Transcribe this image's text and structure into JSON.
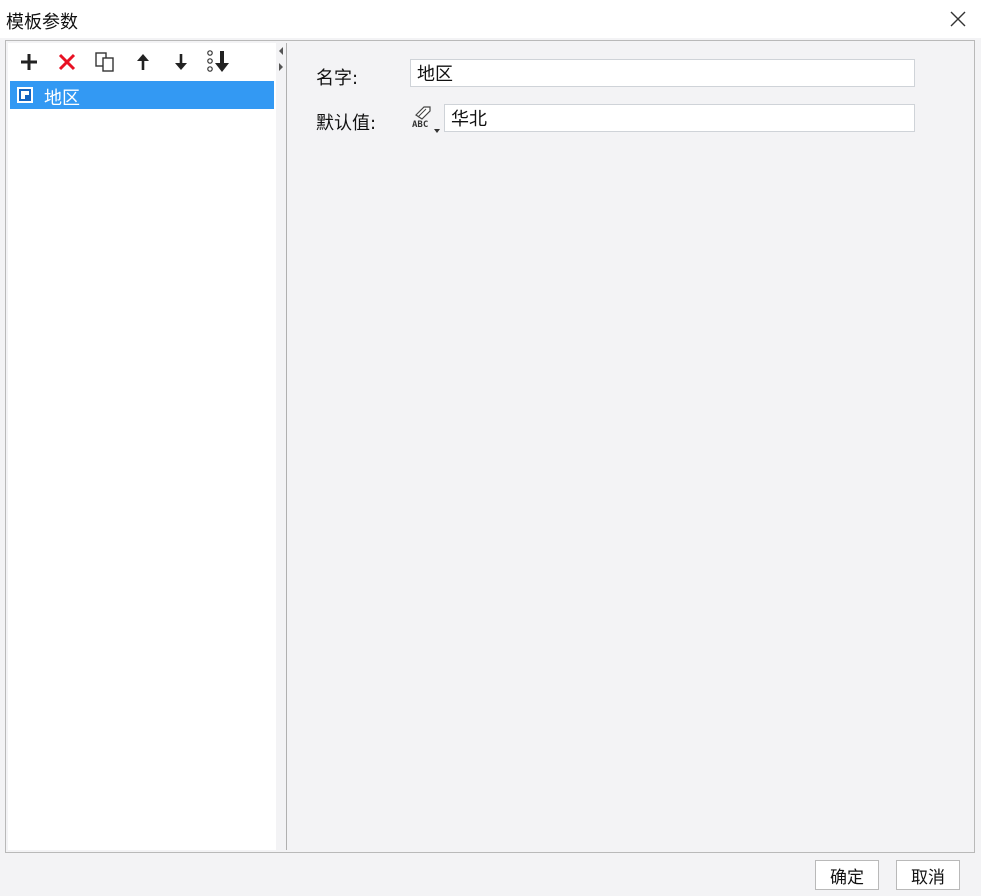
{
  "window": {
    "title": "模板参数"
  },
  "toolbar": {
    "buttons": [
      {
        "name": "add-icon"
      },
      {
        "name": "delete-icon"
      },
      {
        "name": "copy-icon"
      },
      {
        "name": "move-up-icon"
      },
      {
        "name": "move-down-icon"
      },
      {
        "name": "move-to-bottom-icon"
      }
    ]
  },
  "tree": {
    "items": [
      {
        "label": "地区",
        "selected": true
      }
    ]
  },
  "form": {
    "name_label": "名字:",
    "name_value": "地区",
    "default_label": "默认值:",
    "default_value": "华北",
    "type_icon": "abc-string-type-icon",
    "type_icon_text": "ABC"
  },
  "buttons": {
    "ok": "确定",
    "cancel": "取消"
  },
  "colors": {
    "selection": "#3399f3",
    "delete": "#e81123",
    "background": "#f3f3f5"
  }
}
